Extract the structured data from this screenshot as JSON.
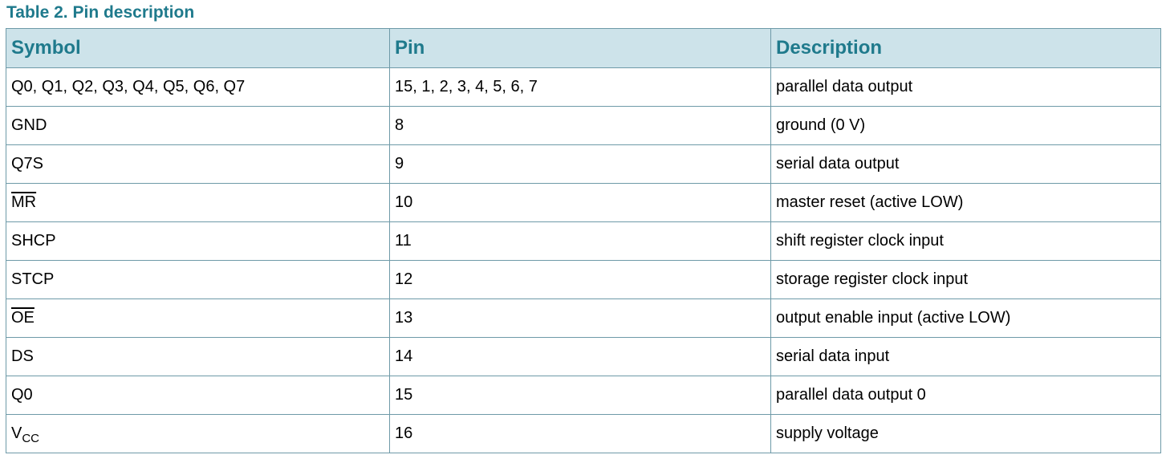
{
  "caption": "Table 2. Pin description",
  "headers": {
    "symbol": "Symbol",
    "pin": "Pin",
    "description": "Description"
  },
  "rows": [
    {
      "symbol": "Q0, Q1, Q2, Q3, Q4, Q5, Q6, Q7",
      "pin": "15, 1, 2, 3, 4, 5, 6, 7",
      "description": "parallel data output"
    },
    {
      "symbol": "GND",
      "pin": "8",
      "description": "ground (0 V)"
    },
    {
      "symbol": "Q7S",
      "pin": "9",
      "description": "serial data output"
    },
    {
      "symbol": "MR",
      "symbol_overline": true,
      "pin": "10",
      "description": "master reset (active LOW)"
    },
    {
      "symbol": "SHCP",
      "pin": "11",
      "description": "shift register clock input"
    },
    {
      "symbol": "STCP",
      "pin": "12",
      "description": "storage register clock input"
    },
    {
      "symbol": "OE",
      "symbol_overline": true,
      "pin": "13",
      "description": "output enable input (active LOW)"
    },
    {
      "symbol": "DS",
      "pin": "14",
      "description": "serial data input"
    },
    {
      "symbol": "Q0",
      "pin": "15",
      "description": "parallel data output 0"
    },
    {
      "symbol": "V",
      "symbol_subscript": "CC",
      "pin": "16",
      "description": "supply voltage"
    }
  ],
  "colors": {
    "caption": "#1f7a8c",
    "header_bg": "#cde3ea",
    "border": "#6e9aa8"
  }
}
